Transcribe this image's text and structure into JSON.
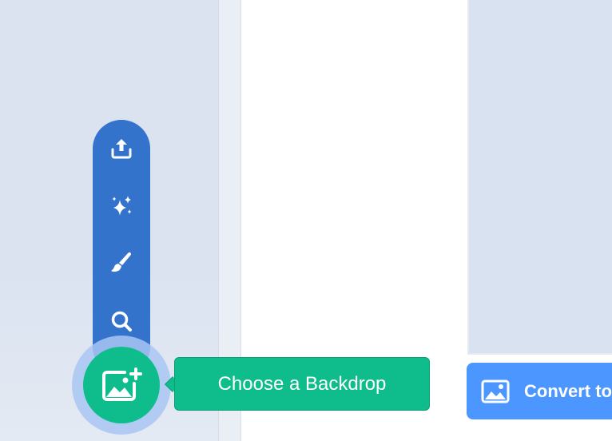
{
  "backdrop_menu": {
    "items": [
      {
        "name": "upload",
        "icon": "upload-icon"
      },
      {
        "name": "surprise",
        "icon": "sparkle-icon"
      },
      {
        "name": "paint",
        "icon": "paintbrush-icon"
      },
      {
        "name": "choose",
        "icon": "search-icon"
      }
    ],
    "main_button_icon": "add-backdrop-icon",
    "tooltip": "Choose a Backdrop"
  },
  "canvas": {
    "convert_label": "Convert to"
  },
  "colors": {
    "menu_blue": "#3373cc",
    "accent_green": "#0fbd8c",
    "convert_blue": "#4c97ff",
    "panel_bg": "#d9e2f1"
  }
}
